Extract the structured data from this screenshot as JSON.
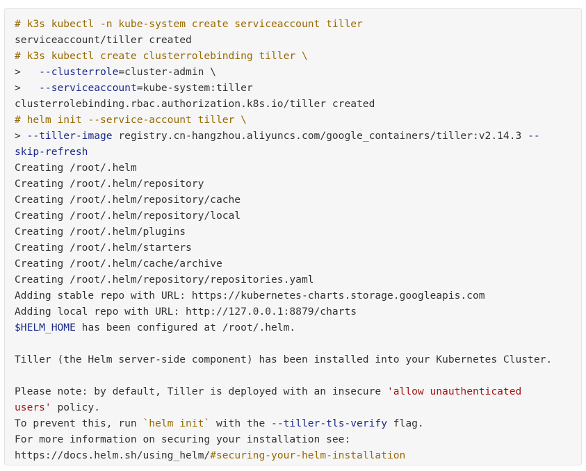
{
  "colors": {
    "background": "#f6f6f6",
    "border": "#e3e3e3",
    "text": "#333333",
    "comment": "#986801",
    "flag": "#1b2a8c",
    "string": "#a31515"
  },
  "lines": [
    [
      {
        "t": "comment",
        "v": "# k3s kubectl -n kube-system create serviceaccount tiller"
      }
    ],
    [
      {
        "t": "plain",
        "v": "serviceaccount/tiller created"
      }
    ],
    [
      {
        "t": "comment",
        "v": "# k3s kubectl create clusterrolebinding tiller \\"
      }
    ],
    [
      {
        "t": "plain",
        "v": ">   "
      },
      {
        "t": "flag",
        "v": "--clusterrole"
      },
      {
        "t": "plain",
        "v": "=cluster-admin \\"
      }
    ],
    [
      {
        "t": "plain",
        "v": ">   "
      },
      {
        "t": "flag",
        "v": "--serviceaccount"
      },
      {
        "t": "plain",
        "v": "=kube-system:tiller"
      }
    ],
    [
      {
        "t": "plain",
        "v": "clusterrolebinding.rbac.authorization.k8s.io/tiller created"
      }
    ],
    [
      {
        "t": "comment",
        "v": "# helm init --service-account tiller \\"
      }
    ],
    [
      {
        "t": "plain",
        "v": "> "
      },
      {
        "t": "flag",
        "v": "--tiller-image"
      },
      {
        "t": "plain",
        "v": " registry.cn-hangzhou.aliyuncs.com/google_containers/tiller:v2.14.3 "
      },
      {
        "t": "flag",
        "v": "--"
      }
    ],
    [
      {
        "t": "flag",
        "v": "skip-refresh"
      }
    ],
    [
      {
        "t": "plain",
        "v": "Creating /root/.helm"
      }
    ],
    [
      {
        "t": "plain",
        "v": "Creating /root/.helm/repository"
      }
    ],
    [
      {
        "t": "plain",
        "v": "Creating /root/.helm/repository/cache"
      }
    ],
    [
      {
        "t": "plain",
        "v": "Creating /root/.helm/repository/local"
      }
    ],
    [
      {
        "t": "plain",
        "v": "Creating /root/.helm/plugins"
      }
    ],
    [
      {
        "t": "plain",
        "v": "Creating /root/.helm/starters"
      }
    ],
    [
      {
        "t": "plain",
        "v": "Creating /root/.helm/cache/archive"
      }
    ],
    [
      {
        "t": "plain",
        "v": "Creating /root/.helm/repository/repositories.yaml"
      }
    ],
    [
      {
        "t": "plain",
        "v": "Adding stable repo with URL: https://kubernetes-charts.storage.googleapis.com"
      }
    ],
    [
      {
        "t": "plain",
        "v": "Adding local repo with URL: http://127.0.0.1:8879/charts"
      }
    ],
    [
      {
        "t": "var",
        "v": "$HELM_HOME"
      },
      {
        "t": "plain",
        "v": " has been configured at /root/.helm."
      }
    ],
    [],
    [
      {
        "t": "plain",
        "v": "Tiller (the Helm server-side component) has been installed into your Kubernetes Cluster."
      }
    ],
    [],
    [
      {
        "t": "plain",
        "v": "Please note: by default, Tiller is deployed with an insecure "
      },
      {
        "t": "string",
        "v": "'allow unauthenticated"
      }
    ],
    [
      {
        "t": "string",
        "v": "users'"
      },
      {
        "t": "plain",
        "v": " policy."
      }
    ],
    [
      {
        "t": "plain",
        "v": "To prevent this, run "
      },
      {
        "t": "tick",
        "v": "`helm init`"
      },
      {
        "t": "plain",
        "v": " with the "
      },
      {
        "t": "flag",
        "v": "--tiller-tls-verify"
      },
      {
        "t": "plain",
        "v": " flag."
      }
    ],
    [
      {
        "t": "plain",
        "v": "For more information on securing your installation see:"
      }
    ],
    [
      {
        "t": "plain",
        "v": "https://docs.helm.sh/using_helm/"
      },
      {
        "t": "comment",
        "v": "#securing-your-helm-installation"
      }
    ]
  ]
}
